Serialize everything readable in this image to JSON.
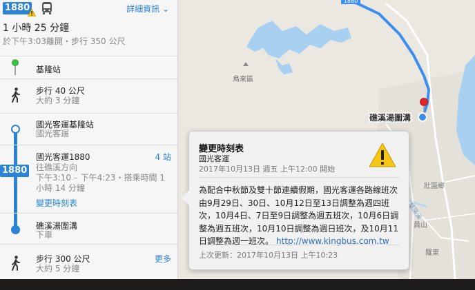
{
  "header": {
    "route_badge": "1880",
    "details_link": "詳細資訊 ⌄",
    "duration": "1 小時 25 分鐘",
    "departure": "於下午3:03離開・步行 350 公尺"
  },
  "steps": [
    {
      "title": "基隆站"
    },
    {
      "title": "步行 40 公尺",
      "sub": "大約 3 分鐘"
    },
    {
      "title": "國光客運基隆站",
      "sub": "國光客運"
    },
    {
      "title": "國光客運1880",
      "right": "4 站",
      "sub1": "往礁溪方向",
      "sub2": "下午3:10 – 下午4:23・搭乘時間 1",
      "sub3": "小時 14 分鐘",
      "link": "變更時刻表"
    },
    {
      "title": "礁溪湯圍溝",
      "sub": "下車"
    },
    {
      "title": "步行 300 公尺",
      "sub": "大約 5 分鐘",
      "right": "更多"
    }
  ],
  "line_badge": "1880",
  "map": {
    "labels": {
      "road_shield": "1880",
      "district": "烏來區",
      "destination": "礁溪湯圍溝",
      "yilan": "宜蘭",
      "zhuangwei": "壯圍鄉",
      "yuanshan": "員山",
      "luodong": "羅東"
    },
    "route_color": "#3b8ef0",
    "water_color": "#a8d0f0"
  },
  "popover": {
    "title": "變更時刻表",
    "agency": "國光客運",
    "date": "2017年10月13日 週五 上午12:00 開始",
    "body": "為配合中秋節及雙十節連續假期，國光客運各路線班次由9月29日、30日、10月12日至13日調整為週四班次，10月4日、7日至9日調整為週五班次，10月6日調整為週五班次，10月10日調整為週日班次，及10月11日調整為週一班次。",
    "link": "http://www.kingbus.com.tw",
    "updated": "上次更新：2017年10月13日 上午10:23"
  }
}
